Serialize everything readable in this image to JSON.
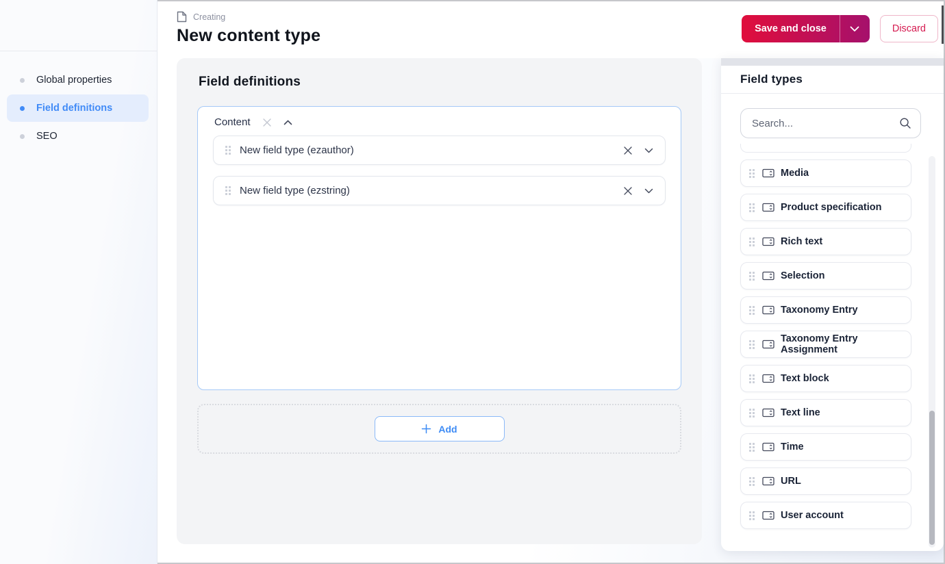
{
  "window": {
    "kicker": "Creating",
    "title": "New content type"
  },
  "actions": {
    "save_label": "Save and close",
    "discard_label": "Discard"
  },
  "sidebar": {
    "items": [
      {
        "label": "Global properties",
        "active": false
      },
      {
        "label": "Field definitions",
        "active": true
      },
      {
        "label": "SEO",
        "active": false
      }
    ]
  },
  "definitions": {
    "heading": "Field definitions",
    "group": {
      "label": "Content",
      "fields": [
        {
          "label": "New field type (ezauthor)"
        },
        {
          "label": "New field type (ezstring)"
        }
      ]
    },
    "add_label": "Add"
  },
  "field_types": {
    "heading": "Field types",
    "search_placeholder": "Search...",
    "items": [
      "Media",
      "Product specification",
      "Rich text",
      "Selection",
      "Taxonomy Entry",
      "Taxonomy Entry Assignment",
      "Text block",
      "Text line",
      "Time",
      "URL",
      "User account"
    ]
  },
  "colors": {
    "primary_gradient_start": "#e00e3c",
    "primary_gradient_end": "#a5116c",
    "accent_blue": "#418bf7",
    "danger_text": "#d51a50",
    "group_border_blue": "#a5c9f7",
    "panel_gray": "#f3f4f6"
  },
  "icons": {
    "kicker": "document-icon",
    "save_caret": "chevron-down-icon",
    "group_remove": "close-icon",
    "group_collapse": "chevron-up-icon",
    "row_drag": "drag-handle-icon",
    "row_remove": "close-icon",
    "row_expand": "chevron-down-icon",
    "add": "plus-icon",
    "search": "search-icon",
    "field_type": "input-field-icon"
  }
}
